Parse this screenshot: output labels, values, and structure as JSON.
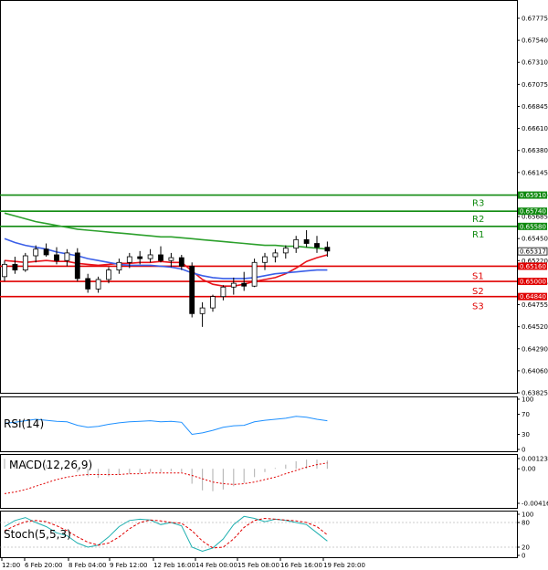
{
  "colors": {
    "bull": "#ffffff",
    "bear": "#000000",
    "wick": "#000000",
    "ma_fast": "#e8131b",
    "ma_mid": "#3b5fe8",
    "ma_slow": "#2ca02c",
    "resistance": "#108a10",
    "support": "#e00000",
    "rsi": "#1e90ff",
    "macd_signal": "#e00000",
    "macd_hist": "#bbbbbb",
    "stoch_main": "#20b0b0",
    "stoch_signal": "#e00000"
  },
  "price_axis": {
    "labels": [
      "0.67775",
      "0.67540",
      "0.67310",
      "0.67075",
      "0.66845",
      "0.66610",
      "0.66380",
      "0.66145",
      "0.65915",
      "0.65685",
      "0.65450",
      "0.65220",
      "0.64985",
      "0.64755",
      "0.64520",
      "0.64290",
      "0.64060",
      "0.63825"
    ],
    "current": "0.65317"
  },
  "levels": [
    {
      "name": "R3",
      "price_label": "0.65910",
      "kind": "resistance"
    },
    {
      "name": "R2",
      "price_label": "0.65740",
      "kind": "resistance"
    },
    {
      "name": "R1",
      "price_label": "0.65580",
      "kind": "resistance"
    },
    {
      "name": "S1",
      "price_label": "0.65160",
      "kind": "support"
    },
    {
      "name": "S2",
      "price_label": "0.65000",
      "kind": "support"
    },
    {
      "name": "S3",
      "price_label": "0.64840",
      "kind": "support"
    }
  ],
  "time_axis": [
    "12:00",
    "6 Feb 20:00",
    "8 Feb 04:00",
    "9 Feb 12:00",
    "12 Feb 16:00",
    "14 Feb 00:00",
    "15 Feb 08:00",
    "16 Feb 16:00",
    "19 Feb 20:00"
  ],
  "rsi": {
    "label": "RSI(14)",
    "axis": [
      "100",
      "70",
      "30",
      "0"
    ]
  },
  "macd": {
    "label": "MACD(12,26,9)",
    "axis": [
      "0.001231",
      "0.00",
      "-0.004162"
    ]
  },
  "stoch": {
    "label": "Stoch(5,5,3)",
    "axis": [
      "100",
      "80",
      "20",
      "0"
    ]
  },
  "chart_data": {
    "type": "candlestick",
    "series": [
      {
        "name": "Price",
        "values": [
          [
            0.6505,
            0.6522,
            0.65,
            0.6518
          ],
          [
            0.6518,
            0.6526,
            0.6508,
            0.6512
          ],
          [
            0.6512,
            0.653,
            0.651,
            0.6527
          ],
          [
            0.6527,
            0.6538,
            0.652,
            0.6534
          ],
          [
            0.6534,
            0.654,
            0.6526,
            0.6528
          ],
          [
            0.6528,
            0.6536,
            0.6518,
            0.6522
          ],
          [
            0.6522,
            0.6534,
            0.6516,
            0.653
          ],
          [
            0.653,
            0.6535,
            0.65,
            0.6503
          ],
          [
            0.6503,
            0.6508,
            0.6488,
            0.6492
          ],
          [
            0.6492,
            0.6505,
            0.6488,
            0.6502
          ],
          [
            0.6502,
            0.6515,
            0.6498,
            0.6512
          ],
          [
            0.6512,
            0.6524,
            0.6508,
            0.652
          ],
          [
            0.652,
            0.653,
            0.6514,
            0.6526
          ],
          [
            0.6526,
            0.6532,
            0.6518,
            0.6524
          ],
          [
            0.6524,
            0.6534,
            0.652,
            0.6528
          ],
          [
            0.6528,
            0.6537,
            0.652,
            0.6522
          ],
          [
            0.6522,
            0.653,
            0.6515,
            0.6525
          ],
          [
            0.6525,
            0.6528,
            0.6512,
            0.6516
          ],
          [
            0.6516,
            0.652,
            0.6462,
            0.6466
          ],
          [
            0.6466,
            0.6478,
            0.6452,
            0.6472
          ],
          [
            0.6472,
            0.6486,
            0.6468,
            0.6484
          ],
          [
            0.6484,
            0.6496,
            0.648,
            0.6494
          ],
          [
            0.6494,
            0.6504,
            0.6486,
            0.6498
          ],
          [
            0.6498,
            0.651,
            0.649,
            0.6495
          ],
          [
            0.6495,
            0.6524,
            0.6494,
            0.652
          ],
          [
            0.652,
            0.653,
            0.6512,
            0.6526
          ],
          [
            0.6526,
            0.6534,
            0.652,
            0.653
          ],
          [
            0.653,
            0.6538,
            0.6524,
            0.6535
          ],
          [
            0.6535,
            0.6548,
            0.653,
            0.6544
          ],
          [
            0.6544,
            0.6554,
            0.6536,
            0.654
          ],
          [
            0.654,
            0.6548,
            0.653,
            0.6536
          ],
          [
            0.6536,
            0.6542,
            0.6526,
            0.6532
          ]
        ]
      },
      {
        "name": "MA fast",
        "values": [
          0.6522,
          0.6521,
          0.652,
          0.6521,
          0.6522,
          0.6521,
          0.6521,
          0.6519,
          0.6518,
          0.6517,
          0.6518,
          0.6519,
          0.6519,
          0.652,
          0.652,
          0.6521,
          0.652,
          0.652,
          0.6511,
          0.6502,
          0.6497,
          0.6495,
          0.6495,
          0.6497,
          0.65,
          0.6502,
          0.6504,
          0.6508,
          0.6514,
          0.6521,
          0.6525,
          0.6528
        ]
      },
      {
        "name": "MA mid",
        "values": [
          0.6545,
          0.6541,
          0.6538,
          0.6536,
          0.6534,
          0.6531,
          0.6529,
          0.6527,
          0.6524,
          0.6522,
          0.652,
          0.6518,
          0.6517,
          0.6517,
          0.6517,
          0.6516,
          0.6515,
          0.6513,
          0.6509,
          0.6506,
          0.6504,
          0.6503,
          0.6503,
          0.6503,
          0.6504,
          0.6506,
          0.6508,
          0.6509,
          0.651,
          0.6511,
          0.6512,
          0.6512
        ]
      },
      {
        "name": "MA slow",
        "values": [
          0.6572,
          0.6569,
          0.6566,
          0.6563,
          0.6561,
          0.6559,
          0.6557,
          0.6555,
          0.6554,
          0.6553,
          0.6552,
          0.6551,
          0.655,
          0.6549,
          0.6548,
          0.6547,
          0.6547,
          0.6546,
          0.6545,
          0.6544,
          0.6543,
          0.6542,
          0.6541,
          0.654,
          0.6539,
          0.6538,
          0.6538,
          0.6537,
          0.6537,
          0.6536,
          0.6535,
          0.6534
        ]
      }
    ],
    "rsi_values": [
      52,
      54,
      57,
      60,
      58,
      56,
      55,
      48,
      44,
      46,
      50,
      53,
      55,
      56,
      57,
      55,
      56,
      54,
      30,
      33,
      38,
      44,
      47,
      48,
      55,
      58,
      60,
      62,
      66,
      64,
      60,
      57
    ],
    "macd_hist": [
      0.0012,
      0.001,
      0.0009,
      0.0007,
      0.0005,
      0.0004,
      0.0002,
      -0.0004,
      -0.0009,
      -0.0011,
      -0.0009,
      -0.0007,
      -0.0006,
      -0.0005,
      -0.0004,
      -0.0004,
      -0.0003,
      -0.0004,
      -0.0018,
      -0.0026,
      -0.0027,
      -0.0025,
      -0.0021,
      -0.0017,
      -0.001,
      -0.0004,
      0.0001,
      0.0005,
      0.0009,
      0.0011,
      0.0011,
      0.001
    ],
    "macd_signal": [
      -0.003,
      -0.0028,
      -0.0025,
      -0.0021,
      -0.0017,
      -0.0013,
      -0.001,
      -0.0008,
      -0.0007,
      -0.0007,
      -0.0007,
      -0.0007,
      -0.0006,
      -0.0006,
      -0.0005,
      -0.0005,
      -0.0005,
      -0.0005,
      -0.0008,
      -0.0012,
      -0.0016,
      -0.0018,
      -0.0019,
      -0.0018,
      -0.0016,
      -0.0013,
      -0.001,
      -0.0006,
      -0.0002,
      0.0002,
      0.0005,
      0.0007
    ],
    "stoch_main": [
      70,
      85,
      92,
      80,
      70,
      55,
      48,
      30,
      20,
      25,
      45,
      70,
      85,
      88,
      86,
      75,
      80,
      72,
      20,
      10,
      18,
      40,
      75,
      95,
      90,
      82,
      88,
      85,
      80,
      75,
      55,
      35
    ],
    "stoch_signal": [
      60,
      72,
      82,
      85,
      82,
      72,
      60,
      45,
      32,
      25,
      30,
      45,
      65,
      80,
      86,
      84,
      80,
      78,
      60,
      35,
      18,
      20,
      40,
      68,
      85,
      90,
      88,
      86,
      84,
      80,
      70,
      50
    ]
  }
}
